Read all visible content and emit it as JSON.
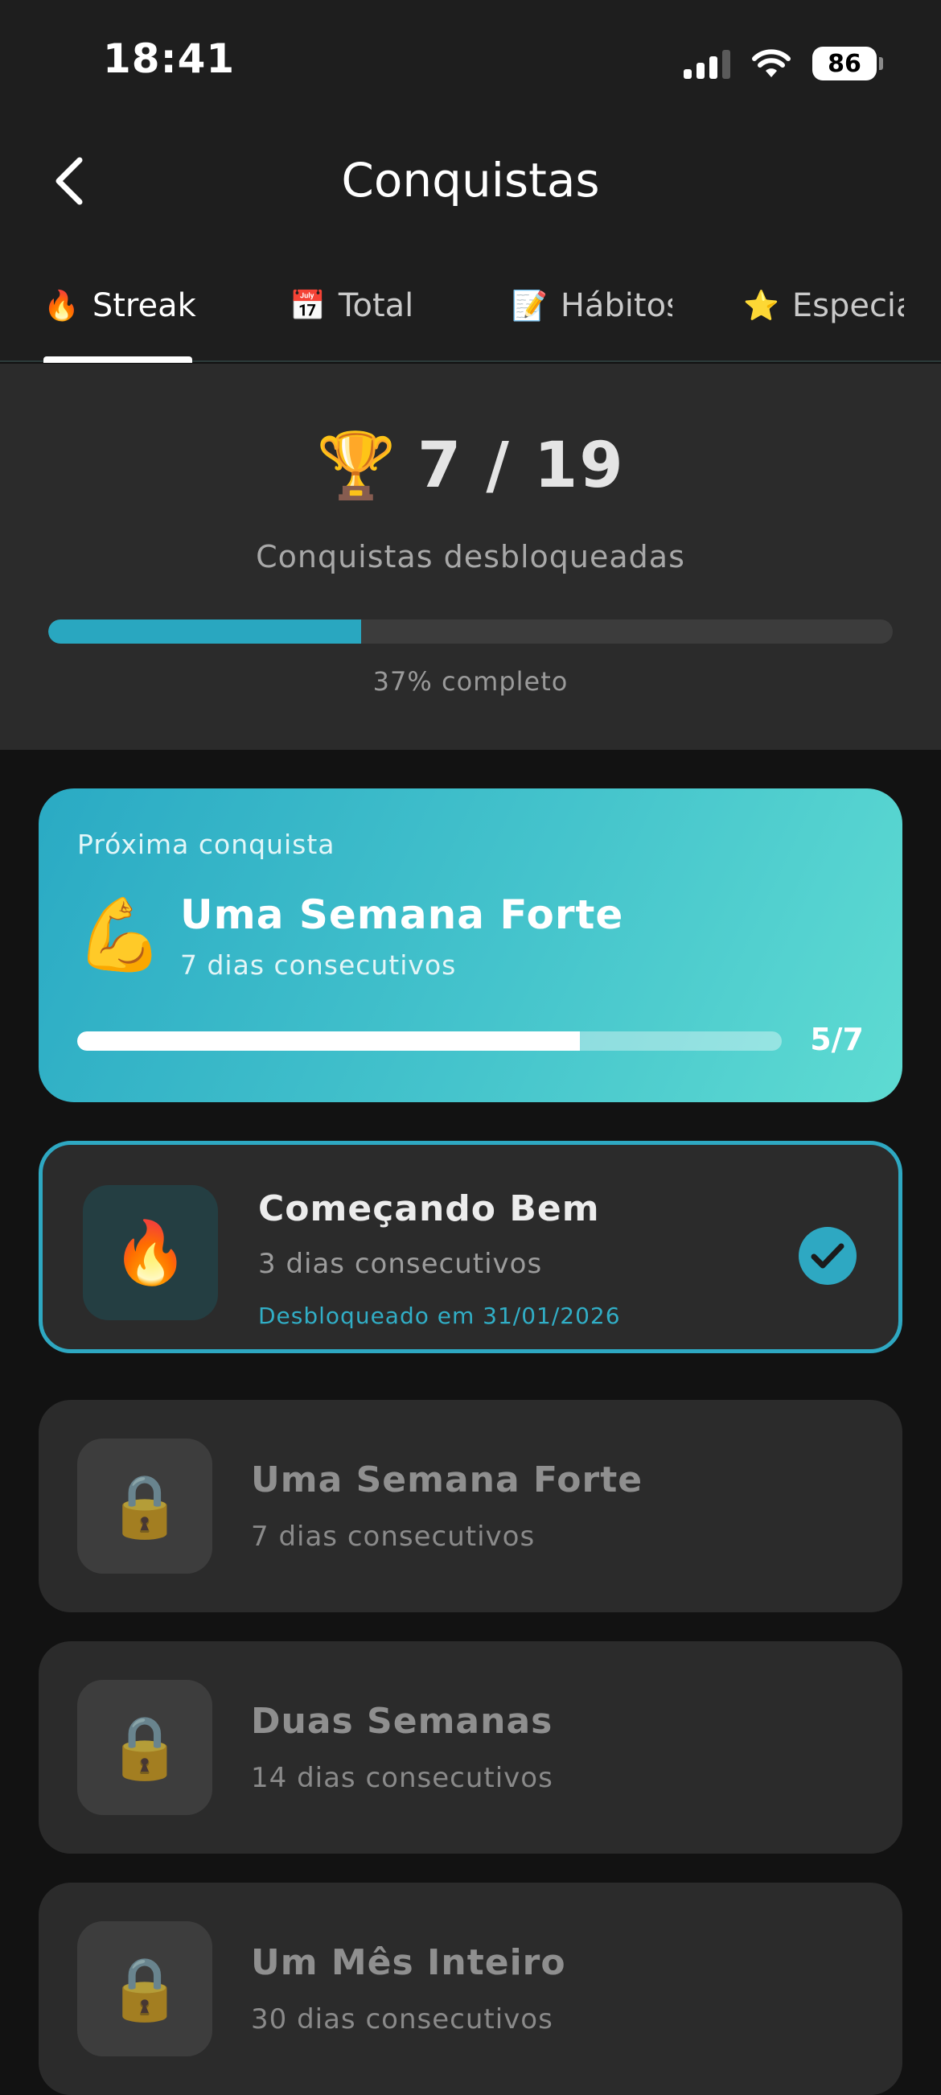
{
  "status_bar": {
    "time": "18:41",
    "battery": "86",
    "icons": [
      "signal-icon",
      "wifi-icon",
      "battery-icon"
    ]
  },
  "header": {
    "back_icon": "chevron-left-icon",
    "title": "Conquistas"
  },
  "tabs": [
    {
      "emoji": "🔥",
      "label": "Streak",
      "active": true
    },
    {
      "emoji": "📅",
      "label": "Total",
      "active": false
    },
    {
      "emoji": "📝",
      "label": "Hábitos",
      "active": false
    },
    {
      "emoji": "⭐",
      "label": "Especiais",
      "active": false
    }
  ],
  "summary": {
    "emoji": "🏆",
    "count": "7 / 19",
    "label": "Conquistas desbloqueadas",
    "progress_fraction": 0.37,
    "percent_text": "37% completo"
  },
  "next_achievement": {
    "label": "Próxima conquista",
    "emoji": "💪",
    "title": "Uma Semana Forte",
    "subtitle": "7 dias consecutivos",
    "progress_fraction": 0.714,
    "progress_text": "5/7"
  },
  "achievements": [
    {
      "emoji": "🔥",
      "title": "Começando Bem",
      "description": "3 dias consecutivos",
      "unlocked_text": "Desbloqueado em 31/01/2026",
      "unlocked": true,
      "status_icon": "check-circle-icon"
    },
    {
      "emoji": "🔒",
      "title": "Uma Semana Forte",
      "description": "7 dias consecutivos",
      "unlocked": false
    },
    {
      "emoji": "🔒",
      "title": "Duas Semanas",
      "description": "14 dias consecutivos",
      "unlocked": false
    },
    {
      "emoji": "🔒",
      "title": "Um Mês Inteiro",
      "description": "30 dias consecutivos",
      "unlocked": false
    }
  ],
  "colors": {
    "accent": "#2ea8c2",
    "background": "#121212",
    "surface": "#2b2b2b",
    "header": "#1e1e1e"
  }
}
